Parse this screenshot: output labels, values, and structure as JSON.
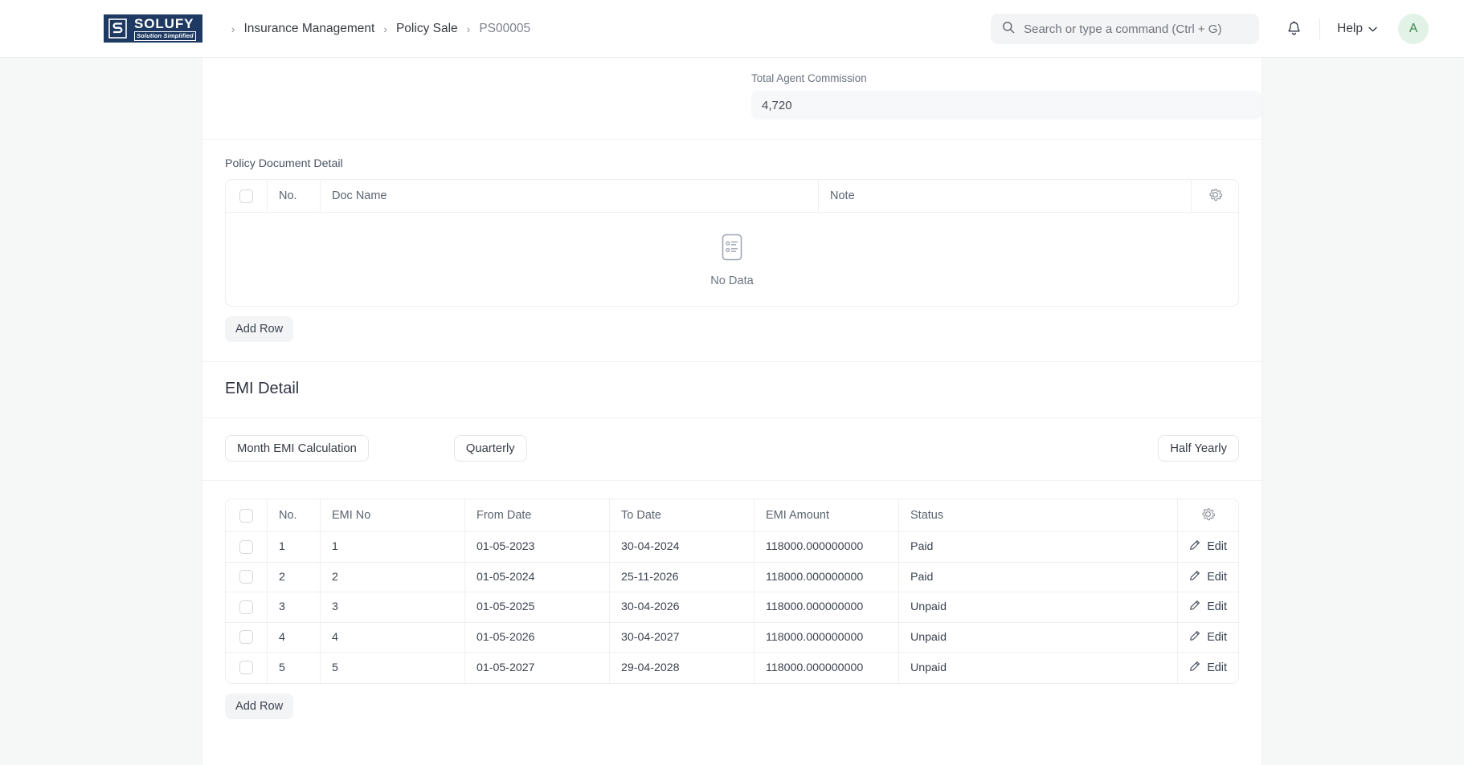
{
  "navbar": {
    "brand": {
      "name": "SOLUFY",
      "tagline": "Solution Simplified",
      "mark_letter": "S"
    },
    "breadcrumb": [
      {
        "label": "Insurance Management",
        "current": false
      },
      {
        "label": "Policy Sale",
        "current": false
      },
      {
        "label": "PS00005",
        "current": true
      }
    ],
    "separator": "›",
    "search": {
      "placeholder": "Search or type a command (Ctrl + G)",
      "value": ""
    },
    "help_label": "Help",
    "avatar_initial": "A",
    "icons": {
      "search": "search-icon",
      "bell": "notification-bell-icon",
      "chevron": "chevron-down-icon"
    }
  },
  "commission": {
    "label": "Total Agent Commission",
    "value": "4,720"
  },
  "policy_document_detail": {
    "title": "Policy Document Detail",
    "columns": [
      "No.",
      "Doc Name",
      "Note"
    ],
    "rows": [],
    "empty_text": "No Data",
    "add_row_label": "Add Row"
  },
  "emi_detail": {
    "title": "EMI Detail",
    "buttons": [
      {
        "label": "Month EMI Calculation"
      },
      {
        "label": "Quarterly"
      },
      {
        "label": "Half Yearly"
      }
    ],
    "columns": [
      "No.",
      "EMI No",
      "From Date",
      "To Date",
      "EMI Amount",
      "Status"
    ],
    "rows": [
      {
        "no": "1",
        "emi_no": "1",
        "from_date": "01-05-2023",
        "to_date": "30-04-2024",
        "amount": "118000.000000000",
        "status": "Paid",
        "edit": "Edit"
      },
      {
        "no": "2",
        "emi_no": "2",
        "from_date": "01-05-2024",
        "to_date": "25-11-2026",
        "amount": "118000.000000000",
        "status": "Paid",
        "edit": "Edit"
      },
      {
        "no": "3",
        "emi_no": "3",
        "from_date": "01-05-2025",
        "to_date": "30-04-2026",
        "amount": "118000.000000000",
        "status": "Unpaid",
        "edit": "Edit"
      },
      {
        "no": "4",
        "emi_no": "4",
        "from_date": "01-05-2026",
        "to_date": "30-04-2027",
        "amount": "118000.000000000",
        "status": "Unpaid",
        "edit": "Edit"
      },
      {
        "no": "5",
        "emi_no": "5",
        "from_date": "01-05-2027",
        "to_date": "29-04-2028",
        "amount": "118000.000000000",
        "status": "Unpaid",
        "edit": "Edit"
      }
    ],
    "add_row_label": "Add Row"
  },
  "colors": {
    "brand_navy": "#1e3a63",
    "page_bg": "#f6f8f7",
    "card_bg": "#ffffff",
    "border": "#eceff1",
    "avatar_bg": "#e2f2e6",
    "avatar_fg": "#3b8a4f"
  }
}
